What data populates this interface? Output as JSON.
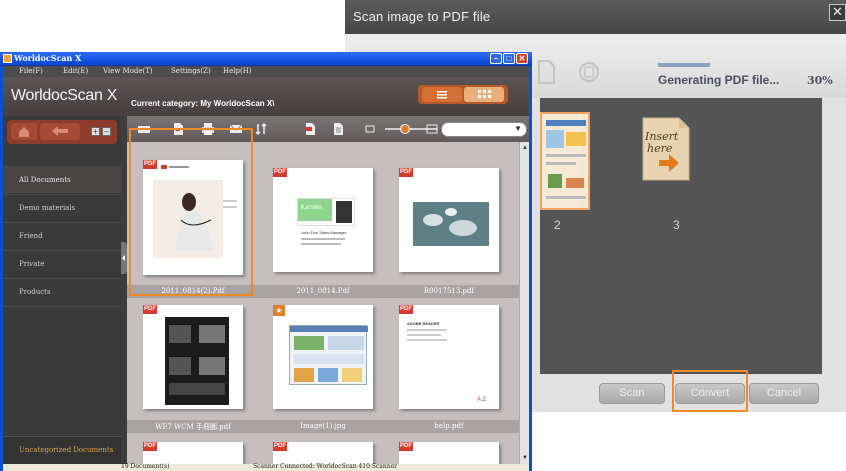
{
  "dialog": {
    "title": "Scan image to PDF file",
    "close_glyph": "✕",
    "progress_percent": 30,
    "status_text": "Generating PDF file...",
    "percent_label": "30%",
    "thumbs": [
      {
        "label": "2"
      },
      {
        "label": "3",
        "insert_text_line1": "Insert",
        "insert_text_line2": "here"
      }
    ],
    "buttons": {
      "scan": "Scan",
      "convert": "Convert",
      "cancel": "Cancel"
    }
  },
  "window": {
    "title": "WorldocScan X",
    "menu": [
      "File(F)",
      "Edit(E)",
      "View Mode(T)",
      "Settings(Z)",
      "Help(H)"
    ],
    "logo": "WorldocScan X",
    "current_category": "Current category: My WorldocScan X\\",
    "sidebar": {
      "items": [
        "All Documents",
        "Demo materials",
        "Friend",
        "Private",
        "Products"
      ],
      "uncategorized": "Uncategorized Documents"
    },
    "captions": {
      "row1": [
        "2011_0814(2).Pdf",
        "2011_0814.Pdf",
        "R0017513.pdf"
      ],
      "row2": [
        "WF7 WCM 手冊圖.pdf",
        "Image(1).jpg",
        "help.pdf"
      ]
    },
    "tiles": {
      "pdf_badge": "PDF",
      "star_badge": "★",
      "card_name": "Karsten",
      "card_line": "John Doe  Sales Manager",
      "doc_heading": "ADOBE READER",
      "help_mark": "A Z"
    },
    "status": {
      "count": "19 Document(s)",
      "scanner": "Scanner Connected:   WorldocScan 410 Scanner"
    }
  },
  "colors": {
    "accent_orange": "#f08a24",
    "titlebar_blue": "#0b4fd2",
    "pdf_red": "#d63a2e"
  }
}
